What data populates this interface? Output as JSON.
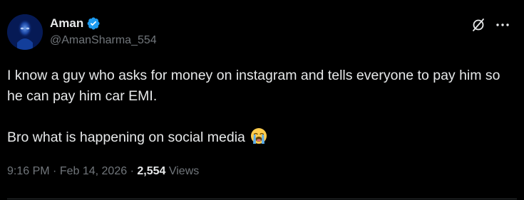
{
  "author": {
    "display_name": "Aman",
    "handle": "@AmanSharma_554",
    "verified_icon": "verified-badge-icon",
    "badge_color": "#1d9bf0"
  },
  "tweet": {
    "line1": "I know a guy who asks for money on instagram and tells everyone to pay him so he can pay him car EMI.",
    "line2": "Bro what is happening on social media",
    "emoji": "loudly-crying-face-emoji"
  },
  "meta": {
    "time": "9:16 PM",
    "separator": "·",
    "date": "Feb 14, 2026",
    "views_count": "2,554",
    "views_label": "Views"
  },
  "actions": {
    "grok_icon": "grok-icon",
    "more_icon": "more-horizontal-icon"
  },
  "colors": {
    "background": "#000000",
    "primary_text": "#e7e9ea",
    "secondary_text": "#71767b",
    "divider": "#2f3336"
  }
}
